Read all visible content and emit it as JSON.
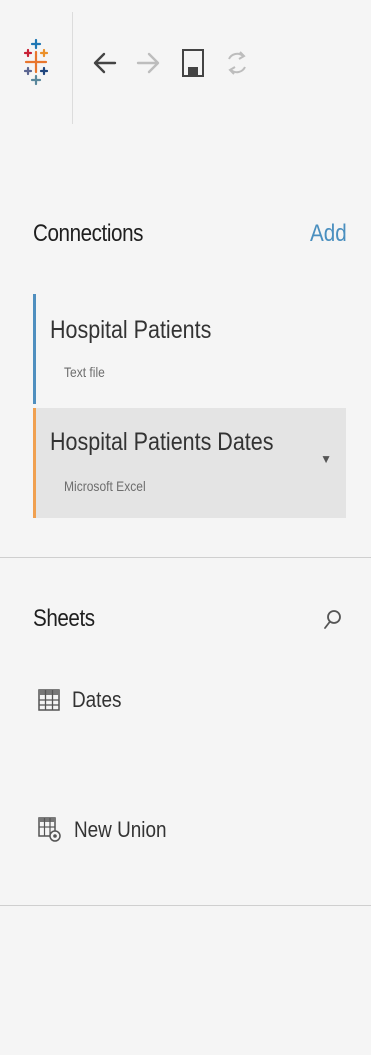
{
  "toolbar": {
    "icons": [
      "tableau-logo-icon",
      "back-icon",
      "forward-icon",
      "save-icon",
      "refresh-icon"
    ]
  },
  "connections": {
    "title": "Connections",
    "add_label": "Add",
    "items": [
      {
        "name": "Hospital Patients",
        "type": "Text file",
        "accent": "#4f8fbf"
      },
      {
        "name": "Hospital Patients Dates",
        "type": "Microsoft Excel",
        "accent": "#f0a050"
      }
    ]
  },
  "sheets": {
    "title": "Sheets",
    "items": [
      {
        "label": "Dates",
        "icon": "table-icon"
      },
      {
        "label": "New Union",
        "icon": "union-icon"
      }
    ]
  }
}
